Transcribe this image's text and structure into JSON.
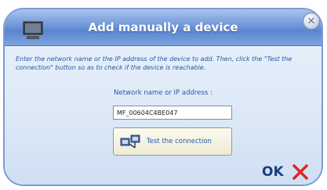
{
  "dialog": {
    "title": "Add manually a device",
    "instructions": "Enter the network name or the IP address of the device to add. Then, click the \"Test the connection\" button so as to check if the device is reachable.",
    "field_label": "Network name or IP address :",
    "address_value": "MF_00604C4BE047",
    "test_button_label": "Test the connection",
    "ok_label": "OK",
    "icons": {
      "device": "monitor-icon",
      "close": "close-icon",
      "test": "network-test-icon",
      "cancel": "red-x-icon"
    },
    "colors": {
      "title_bar": "#6f97d9",
      "text_blue": "#2b57a8",
      "cancel_red": "#e0262a"
    }
  }
}
